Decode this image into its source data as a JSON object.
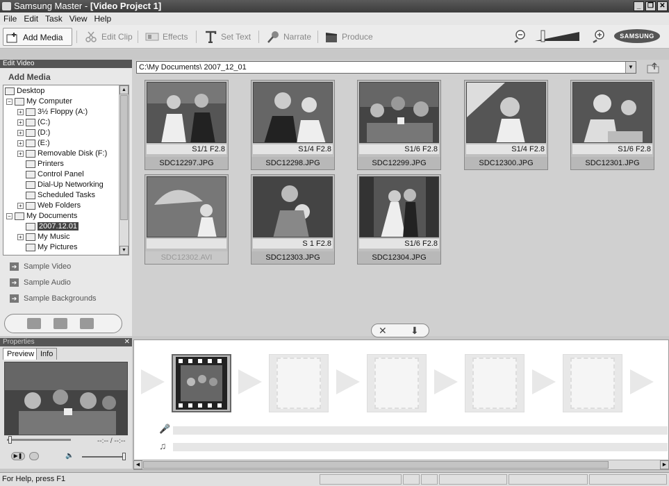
{
  "window": {
    "app_name": "Samsung Master - ",
    "project": "[Video Project 1]",
    "buttons": [
      "_",
      "❐",
      "✕"
    ]
  },
  "menu": [
    "File",
    "Edit",
    "Task",
    "View",
    "Help"
  ],
  "toolbar": {
    "add_media": "Add Media",
    "edit_clip": "Edit Clip",
    "effects": "Effects",
    "set_text": "Set Text",
    "narrate": "Narrate",
    "produce": "Produce",
    "brand": "SAMSUNG"
  },
  "left": {
    "panel_title": "Edit Video",
    "section_title": "Add Media",
    "tree": [
      "Desktop",
      "My Computer",
      "3½ Floppy (A:)",
      "(C:)",
      "(D:)",
      "(E:)",
      "Removable Disk (F:)",
      "Printers",
      "Control Panel",
      "Dial-Up Networking",
      "Scheduled Tasks",
      "Web Folders",
      "My Documents",
      "2007.12.01",
      "My Music",
      "My Pictures"
    ],
    "samples": [
      "Sample Video",
      "Sample Audio",
      "Sample Backgrounds"
    ]
  },
  "properties": {
    "title": "Properties",
    "tabs": [
      "Preview",
      "Info"
    ],
    "time": "--:-- / --:--"
  },
  "path": "C:\\My Documents\\ 2007_12_01",
  "thumbnails": [
    {
      "info": "S1/1 F2.8",
      "name": "SDC12297.JPG"
    },
    {
      "info": "S1/4 F2.8",
      "name": "SDC12298.JPG"
    },
    {
      "info": "S1/6 F2.8",
      "name": "SDC12299.JPG"
    },
    {
      "info": "S1/4 F2.8",
      "name": "SDC12300.JPG"
    },
    {
      "info": "S1/6 F2.8",
      "name": "SDC12301.JPG"
    },
    {
      "info": "",
      "name": "SDC12302.AVI"
    },
    {
      "info": "S 1 F2.8",
      "name": "SDC12303.JPG"
    },
    {
      "info": "S1/6 F2.8",
      "name": "SDC12304.JPG"
    }
  ],
  "status": "For Help, press F1"
}
